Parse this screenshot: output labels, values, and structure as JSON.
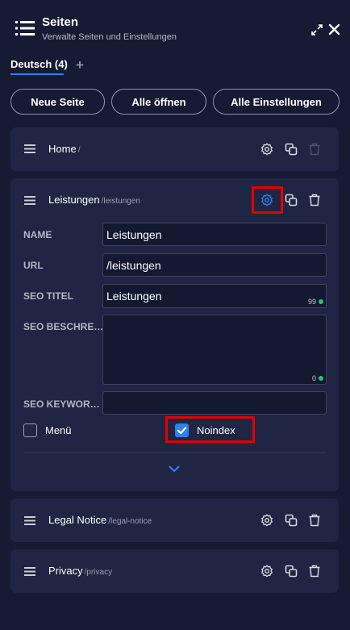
{
  "header": {
    "title": "Seiten",
    "subtitle": "Verwalte Seiten und Einstellungen",
    "icons": [
      "list-icon",
      "expand-icon",
      "close-icon"
    ]
  },
  "tabs": [
    {
      "label": "Deutsch (4)",
      "active": true
    }
  ],
  "tab_add_label": "+",
  "toolbar": {
    "new_page_label": "Neue Seite",
    "open_all_label": "Alle öffnen",
    "all_settings_label": "Alle Einstellungen"
  },
  "pages": [
    {
      "name": "Home",
      "slug": "/"
    },
    {
      "name": "Leistungen",
      "slug": "/leistungen",
      "expanded": true,
      "fields": {
        "name_label": "NAME",
        "name_value": "Leistungen",
        "url_label": "URL",
        "url_value": "/leistungen",
        "seo_title_label": "SEO TITEL",
        "seo_title_value": "Leistungen",
        "seo_title_counter": "99",
        "seo_description_label": "SEO BESCHRE…",
        "seo_description_value": "",
        "seo_description_counter": "0",
        "seo_keywords_label": "SEO KEYWOR…",
        "seo_keywords_value": ""
      },
      "menu_label": "Menü",
      "menu_checked": false,
      "noindex_label": "Noindex",
      "noindex_checked": true
    },
    {
      "name": "Legal Notice",
      "slug": "/legal-notice"
    },
    {
      "name": "Privacy",
      "slug": "/privacy"
    }
  ],
  "colors": {
    "background": "#161b33",
    "card": "#1f2542",
    "accent": "#2f80ed",
    "highlight": "#e60000",
    "counter_ok": "#27c281"
  }
}
